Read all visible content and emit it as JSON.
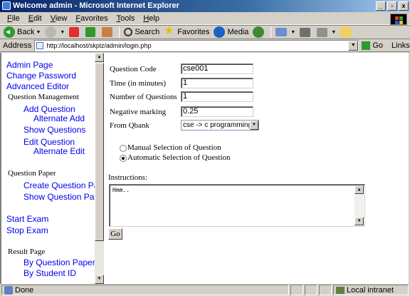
{
  "window": {
    "title": "Welcome admin - Microsoft Internet Explorer",
    "buttons": [
      "_",
      "▫",
      "x"
    ]
  },
  "menu": {
    "items": [
      {
        "mnemonic": "F",
        "rest": "ile"
      },
      {
        "mnemonic": "E",
        "rest": "dit"
      },
      {
        "mnemonic": "V",
        "rest": "iew"
      },
      {
        "mnemonic": "F",
        "rest": "avorites"
      },
      {
        "mnemonic": "T",
        "rest": "ools"
      },
      {
        "mnemonic": "H",
        "rest": "elp"
      }
    ]
  },
  "toolbar": {
    "back": "Back",
    "search": "Search",
    "favorites": "Favorites",
    "media": "Media"
  },
  "address": {
    "label": "Address",
    "url": "http://localhost/skplz/admin/login.php",
    "go": "Go",
    "links": "Links"
  },
  "sidebar": {
    "admin_page": "Admin Page",
    "change_password": "Change Password",
    "advanced_editor": "Advanced Editor",
    "question_management": "Question Management",
    "add_question": "Add Question",
    "alternate_add": "Alternate Add",
    "show_questions": "Show Questions",
    "edit_question": "Edit Question",
    "alternate_edit": "Alternate Edit",
    "question_paper": "Question Paper",
    "create_question_paper": "Create Question Paper",
    "show_question_paper": "Show Question Paper",
    "start_exam": "Start Exam",
    "stop_exam": "Stop Exam",
    "result_page": "Result Page",
    "by_question_paper": "By Question Paper",
    "by_student_id": "By Student ID"
  },
  "form": {
    "question_code_label": "Question Code",
    "question_code_value": "cse001",
    "time_label": "Time (in minutes)",
    "time_value": "1",
    "num_questions_label": "Number of Questions",
    "num_questions_value": "1",
    "negative_label": "Negative marking",
    "negative_value": "0.25",
    "qbank_label": "From Qbank",
    "qbank_value": "cse -> c programming",
    "manual_label": "Manual Selection of Question",
    "automatic_label": "Automatic Selection of Question",
    "instructions_label": "Instructions:",
    "instructions_value": "Hmm..",
    "go_button": "Go"
  },
  "status": {
    "text": "Done",
    "zone": "Local intranet"
  }
}
